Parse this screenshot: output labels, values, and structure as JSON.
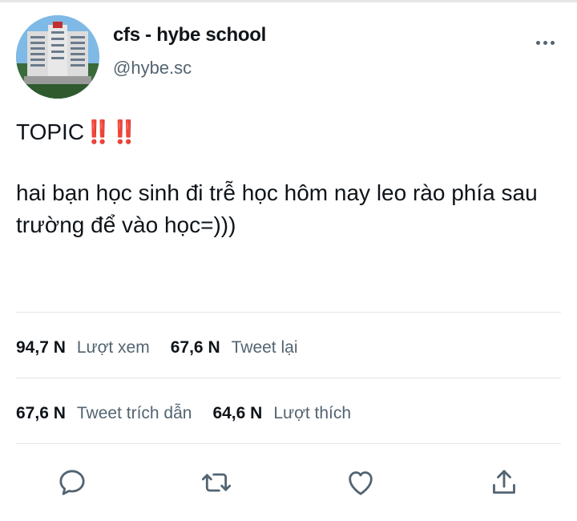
{
  "tweet": {
    "display_name": "cfs - hybe school",
    "handle": "@hybe.sc",
    "text_line1": "TOPIC",
    "text_line1_emoji": "‼️‼️",
    "text_body": "hai bạn học sinh đi trễ học hôm nay leo rào phía sau trường để vào học=)))"
  },
  "stats": {
    "views_count": "94,7 N",
    "views_label": "Lượt xem",
    "retweets_count": "67,6 N",
    "retweets_label": "Tweet lại",
    "quotes_count": "67,6 N",
    "quotes_label": "Tweet trích dẫn",
    "likes_count": "64,6 N",
    "likes_label": "Lượt thích"
  },
  "icons": {
    "more": "more-icon",
    "reply": "reply-icon",
    "retweet": "retweet-icon",
    "like": "heart-icon",
    "share": "share-icon"
  },
  "colors": {
    "text": "#0f1419",
    "secondary": "#536471",
    "icon": "#536471",
    "emoji_red": "#e0181e",
    "divider": "#e5e5e5"
  }
}
